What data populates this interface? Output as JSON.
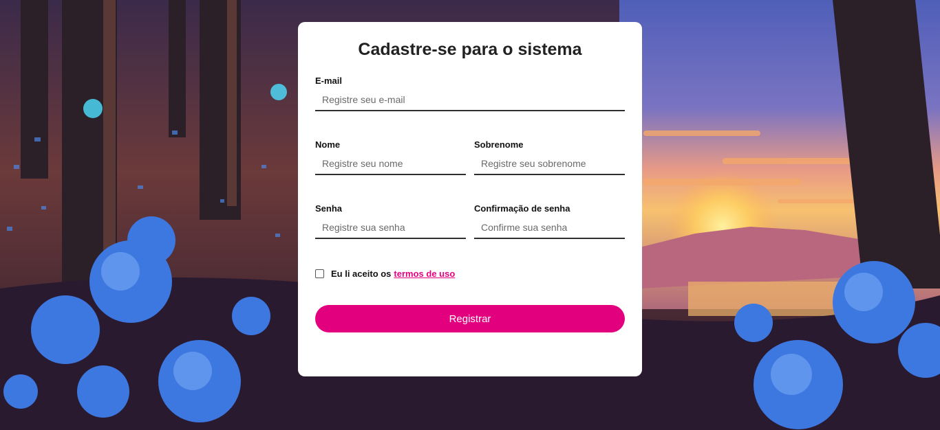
{
  "form": {
    "title": "Cadastre-se para o sistema",
    "email": {
      "label": "E-mail",
      "placeholder": "Registre seu e-mail",
      "value": ""
    },
    "nome": {
      "label": "Nome",
      "placeholder": "Registre seu nome",
      "value": ""
    },
    "sobrenome": {
      "label": "Sobrenome",
      "placeholder": "Registre seu sobrenome",
      "value": ""
    },
    "senha": {
      "label": "Senha",
      "placeholder": "Registre sua senha",
      "value": ""
    },
    "confirmacao": {
      "label": "Confirmação de senha",
      "placeholder": "Confirme sua senha",
      "value": ""
    },
    "terms": {
      "text": "Eu li aceito os",
      "link": "termos de uso",
      "checked": false
    },
    "submit_label": "Registrar"
  },
  "colors": {
    "accent": "#e3007f",
    "card": "#ffffff",
    "sky": "#5b6ec4",
    "sunset": "#f6a45c",
    "flowers": "#3d78e0"
  }
}
